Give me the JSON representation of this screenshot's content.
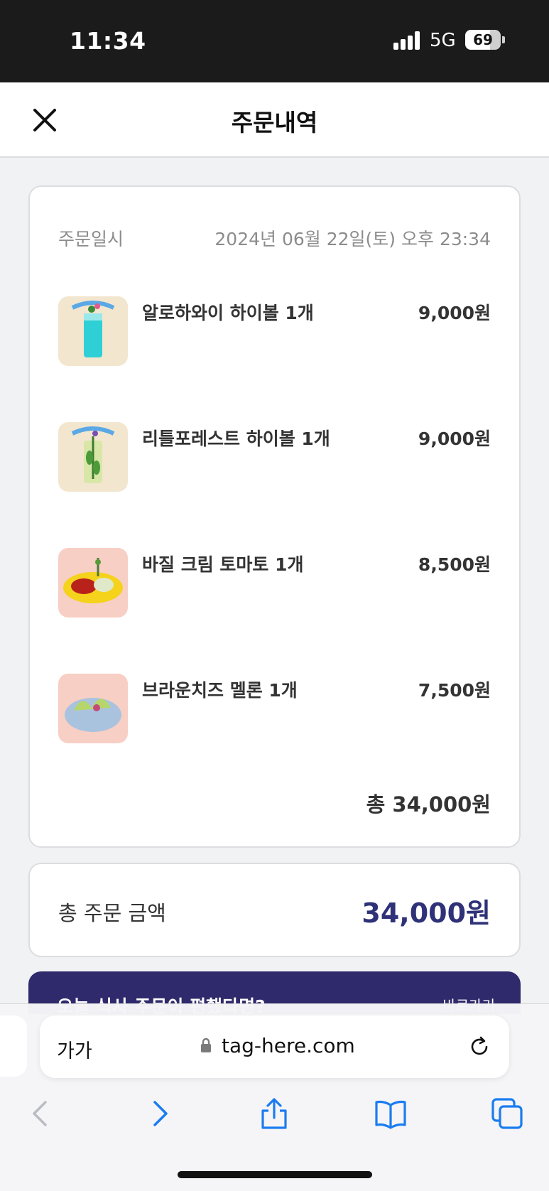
{
  "status_bar": {
    "time": "11:34",
    "network": "5G",
    "battery": "69",
    "battery_level": 0.69
  },
  "header": {
    "title": "주문내역",
    "close_icon": "close-icon"
  },
  "order": {
    "date_label": "주문일시",
    "date_value": "2024년 06월 22일(토) 오후 23:34",
    "items": [
      {
        "name": "알로하와이 하이볼 1개",
        "price": "9,000원",
        "thumb_bg": "#f3e6cf",
        "thumb_icon": "blue-highball-drink-image"
      },
      {
        "name": "리틀포레스트 하이볼 1개",
        "price": "9,000원",
        "thumb_bg": "#f3e6cf",
        "thumb_icon": "herb-highball-drink-image"
      },
      {
        "name": "바질 크림 토마토 1개",
        "price": "8,500원",
        "thumb_bg": "#f7cfc4",
        "thumb_icon": "tomato-dish-image"
      },
      {
        "name": "브라운치즈 멜론 1개",
        "price": "7,500원",
        "thumb_bg": "#f7cfc4",
        "thumb_icon": "melon-dish-image"
      }
    ],
    "subtotal": "총 34,000원"
  },
  "total": {
    "label": "총 주문 금액",
    "value": "34,000원"
  },
  "banner": {
    "text": "오늘 식사 주문이 편했다면?",
    "link": "바로가기"
  },
  "browser": {
    "text_size_label": "가가",
    "url": "tag-here.com",
    "icons": [
      "back-icon",
      "forward-icon",
      "share-icon",
      "bookmarks-icon",
      "tabs-icon"
    ]
  },
  "colors": {
    "accent": "#2f3278",
    "banner": "#2f2a6b",
    "ios_blue": "#1a7cf0"
  }
}
